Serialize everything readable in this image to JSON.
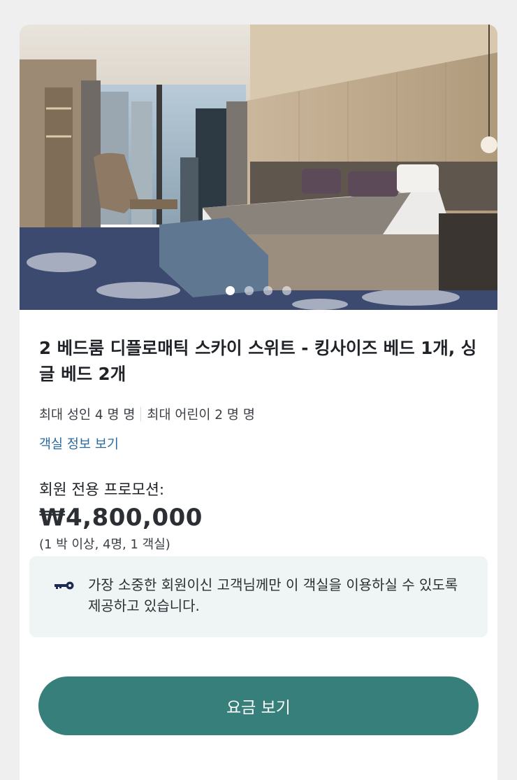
{
  "room": {
    "title": "2 베드룸 디플로매틱 스카이 스위트 - 킹사이즈 베드 1개, 싱글 베드 2개",
    "occupancy_adults": "최대 성인 4 명 명",
    "occupancy_children": "최대 어린이 2 명 명",
    "details_link": "객실 정보 보기"
  },
  "carousel": {
    "total_images": 4,
    "active_index": 0
  },
  "pricing": {
    "promo_label": "회원 전용 프로모션:",
    "price": "₩4,800,000",
    "note": "(1 박 이상, 4명, 1 객실)"
  },
  "member_notice": {
    "icon": "key-icon",
    "text": "가장 소중한 회원이신 고객님께만 이 객실을 이용하실 수 있도록 제공하고 있습니다."
  },
  "cta": {
    "label": "요금 보기"
  },
  "colors": {
    "accent": "#367f7b",
    "link": "#2a6aa0",
    "notice_bg": "#eef5f4",
    "page_bg": "#efefef"
  }
}
